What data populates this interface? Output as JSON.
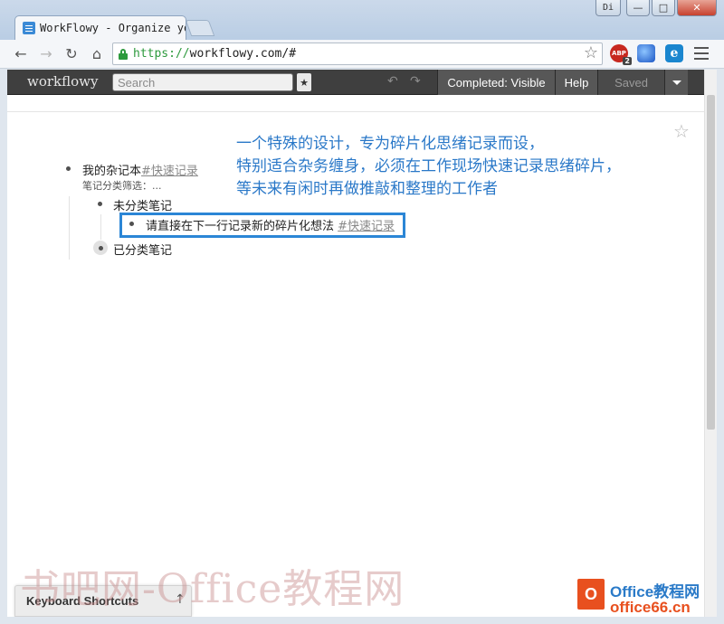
{
  "window": {
    "tab_title": "WorkFlowy - Organize yo",
    "user_badge": "Di",
    "min_glyph": "—",
    "max_glyph": "□",
    "close_glyph": "✕"
  },
  "browser": {
    "url_scheme": "https://",
    "url_host": "workflowy.com/#",
    "abp_label": "ABP",
    "abp_count": "2",
    "ext_e_label": "e"
  },
  "app": {
    "logo": "workflowy",
    "search_placeholder": "Search",
    "completed_label": "Completed: Visible",
    "help_label": "Help",
    "saved_label": "Saved"
  },
  "annotation": {
    "line1": "一个特殊的设计，专为碎片化思绪记录而设，",
    "line2": "特别适合杂务缠身，必须在工作现场快速记录思绪碎片，",
    "line3": "等未来有闲时再做推敲和整理的工作者"
  },
  "outline": {
    "root_label": "我的杂记本",
    "root_tag": "#快速记录",
    "root_note": "笔记分类筛选：...",
    "child1_label": "未分类笔记",
    "grandchild_label": "请直接在下一行记录新的碎片化想法",
    "grandchild_tag": "#快速记录",
    "child2_label": "已分类笔记"
  },
  "footer": {
    "keyboard_shortcuts": "Keyboard Shortcuts",
    "arrow": "↑"
  },
  "overlay": {
    "watermark": "书吧网-Office教程网",
    "brand_line1": "Office教程网",
    "brand_line2": "office66.cn"
  }
}
